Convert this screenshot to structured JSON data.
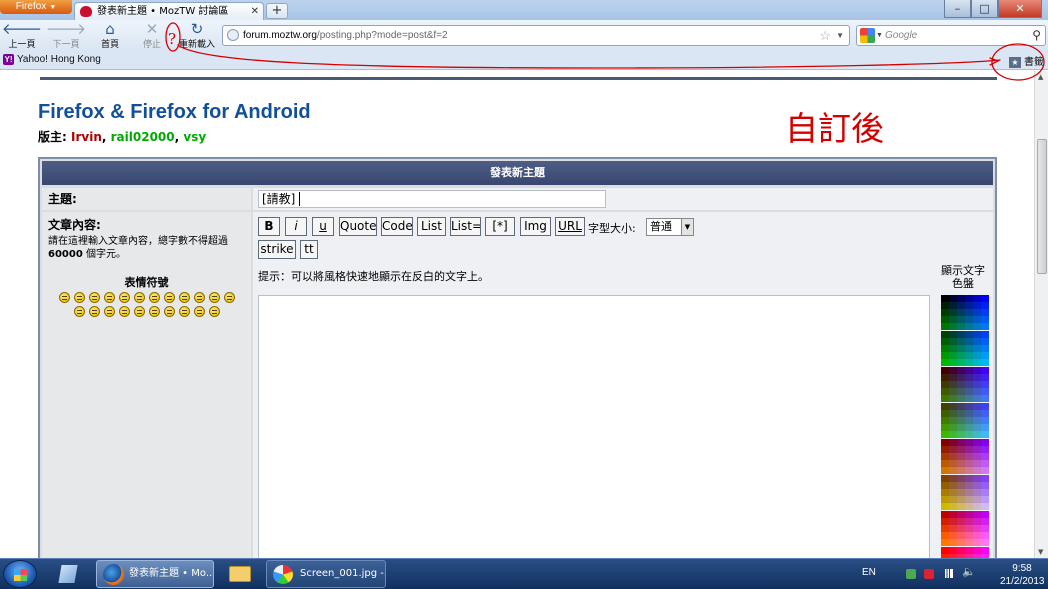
{
  "browser": {
    "app_menu_label": "Firefox",
    "tab_title": "發表新主題 • MozTW 討論區",
    "new_tab_label": "+",
    "window_buttons": {
      "minimize": "–",
      "maximize": "□",
      "close": "✕"
    }
  },
  "navigation": {
    "back_label": "上一頁",
    "forward_label": "下一頁",
    "home_label": "首頁",
    "stop_label": "停止",
    "reload_label": "重新載入",
    "url_domain": "forum.moztw.org",
    "url_path": "/posting.php?mode=post&f=2",
    "search_placeholder": "Google"
  },
  "bookmarks": {
    "items": [
      {
        "label": "Yahoo! Hong Kong"
      }
    ],
    "bookmarks_button_label": "書籤"
  },
  "annotation": {
    "question_mark": "?",
    "handwritten_note": "自訂後",
    "color": "#d40000"
  },
  "page": {
    "forum_title": "Firefox & Firefox for Android",
    "moderators_prefix": "版主:",
    "moderators": [
      "Irvin",
      "rail02000",
      "vsy"
    ],
    "form_header": "發表新主題",
    "subject_label": "主題:",
    "subject_value": "[請教]",
    "body_label": "文章內容:",
    "body_hint_1": "請在這裡輸入文章內容，總字數不得超過",
    "body_hint_limit": "60000",
    "body_hint_2": "個字元。",
    "smilies_title": "表情符號",
    "smiley_count": 22,
    "format_buttons": [
      "B",
      "i",
      "u",
      "Quote",
      "Code",
      "List",
      "List=",
      "[*]",
      "Img",
      "URL",
      "strike",
      "tt"
    ],
    "font_size_label": "字型大小:",
    "font_size_value": "普通",
    "tip_text": "提示：可以將風格快速地顯示在反白的文字上。",
    "palette_title_1": "顯示文字",
    "palette_title_2": "色盤"
  },
  "taskbar": {
    "firefox_label": "發表新主題 • Mo...",
    "paint_label": "Screen_001.jpg -...",
    "language": "EN",
    "time": "9:58",
    "date": "21/2/2013"
  }
}
